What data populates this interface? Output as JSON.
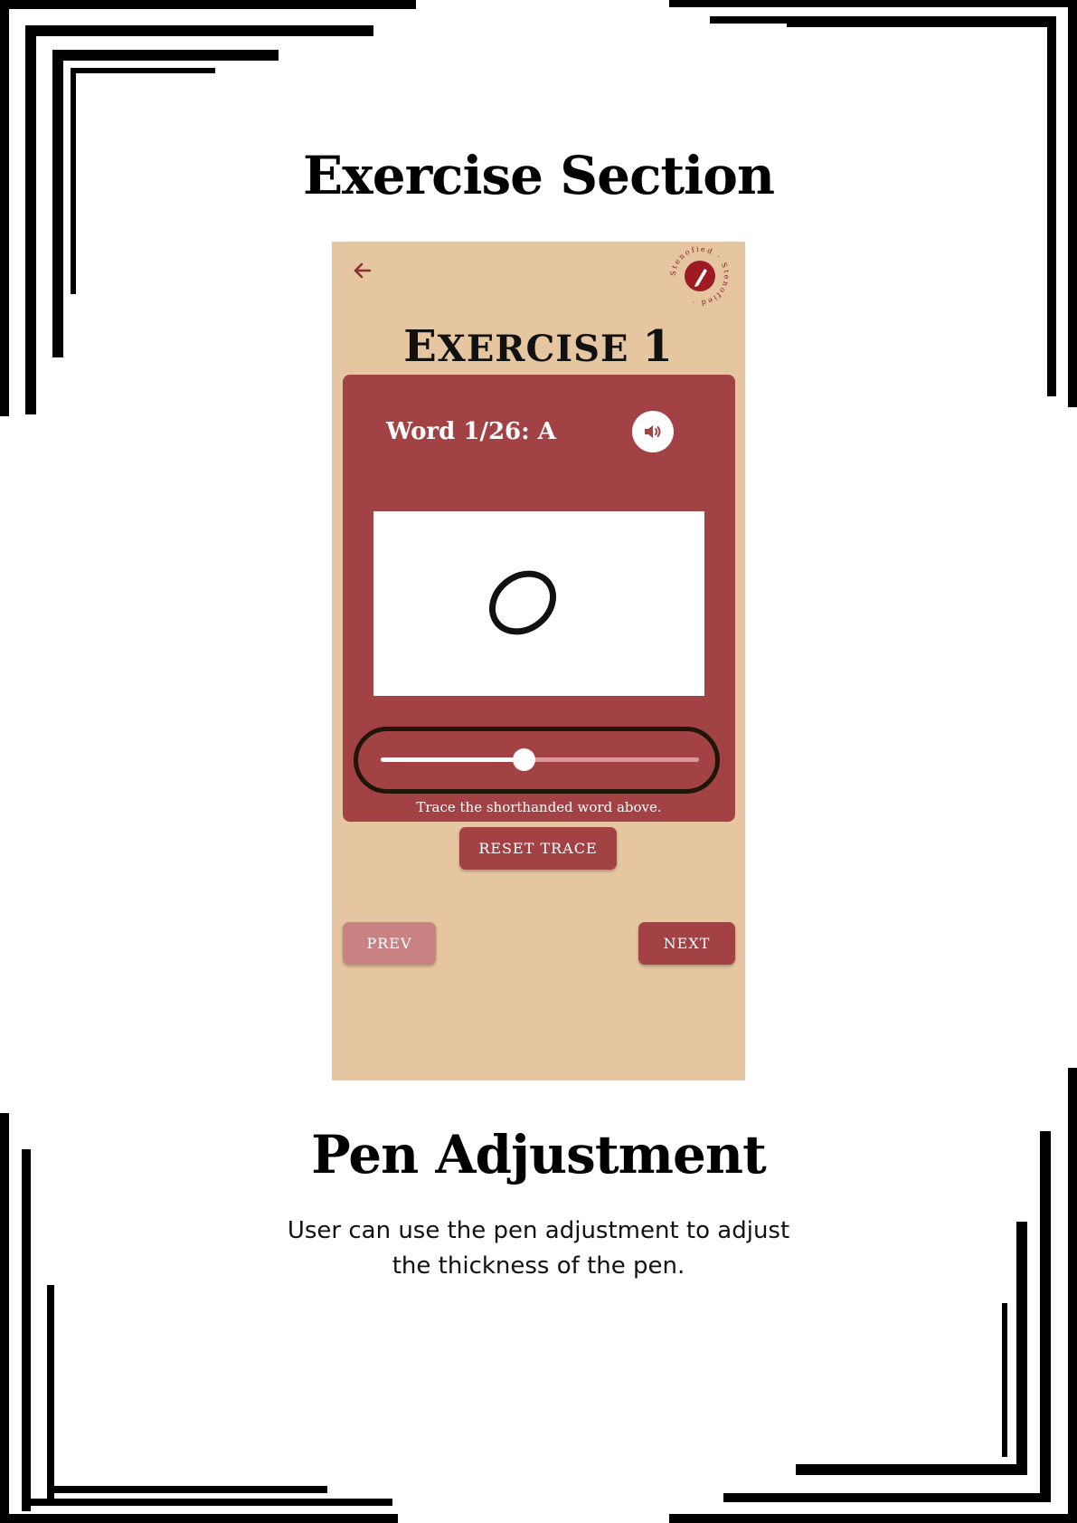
{
  "page": {
    "heading": "Exercise Section",
    "subheading": "Pen Adjustment",
    "caption_line1": "User can use the pen adjustment to adjust",
    "caption_line2": "the thickness of the pen."
  },
  "app": {
    "back_icon": "arrow-left-icon",
    "logo_text": "Stenofied",
    "exercise_title_first": "E",
    "exercise_title_rest": "XERCISE ",
    "exercise_title_number": "1",
    "word_label": "Word 1/26: A",
    "sound_icon": "speaker-icon",
    "pen_thickness": 0.45,
    "hint": "Trace the shorthanded word above.",
    "reset_label": "RESET TRACE",
    "prev_label": "PREV",
    "next_label": "NEXT"
  },
  "colors": {
    "background": "#e5c6a0",
    "card": "#a24245",
    "prev_disabled": "#c98282",
    "highlight": "#1f1508"
  }
}
